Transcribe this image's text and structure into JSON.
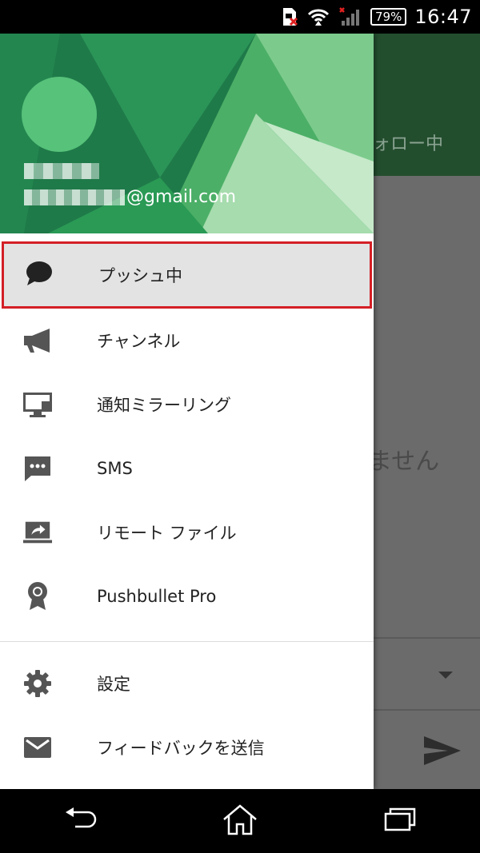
{
  "status_bar": {
    "battery": "79%",
    "time": "16:47"
  },
  "background_app": {
    "tab_partial": "ォロー中",
    "empty_partial": "ません"
  },
  "drawer": {
    "header": {
      "email_domain": "@gmail.com"
    },
    "items": [
      {
        "label": "プッシュ中",
        "icon": "chat-bubble-icon",
        "active": true
      },
      {
        "label": "チャンネル",
        "icon": "megaphone-icon"
      },
      {
        "label": "通知ミラーリング",
        "icon": "monitor-icon"
      },
      {
        "label": "SMS",
        "icon": "sms-icon"
      },
      {
        "label": "リモート ファイル",
        "icon": "remote-file-icon"
      },
      {
        "label": "Pushbullet Pro",
        "icon": "badge-icon"
      }
    ],
    "secondary_items": [
      {
        "label": "設定",
        "icon": "gear-icon"
      },
      {
        "label": "フィードバックを送信",
        "icon": "mail-icon"
      }
    ]
  },
  "colors": {
    "accent_red": "#d31f26",
    "header_green": "#1f7a47",
    "toolbar_dark_green": "#234e2e"
  }
}
